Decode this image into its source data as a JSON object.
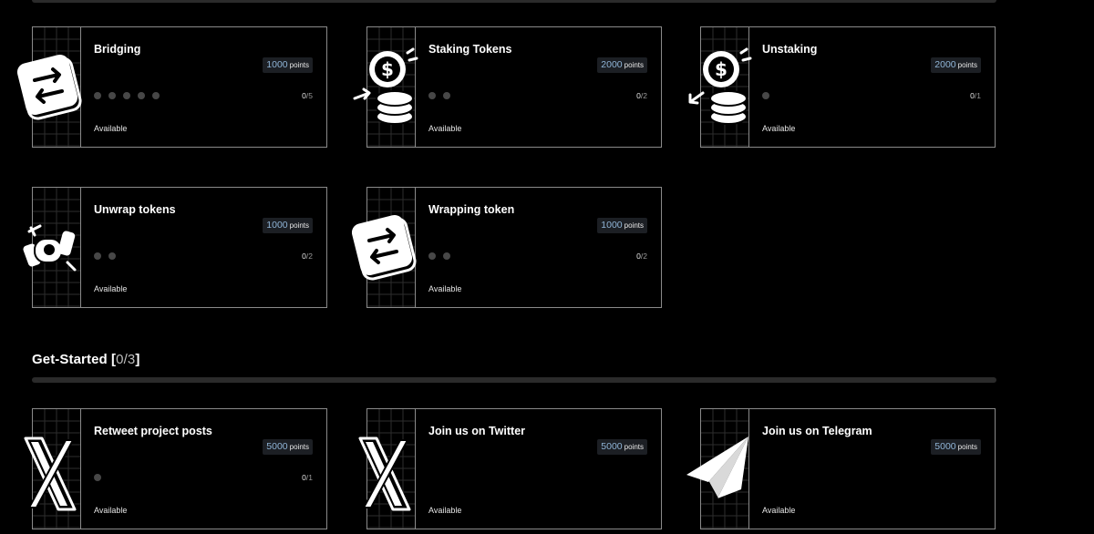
{
  "sections": {
    "get_started": {
      "title": "Get-Started",
      "done": "0",
      "total": "3"
    }
  },
  "cards": [
    {
      "title": "Bridging",
      "points": "1000",
      "points_unit": "points",
      "done": "0",
      "total": "5",
      "dots": 5,
      "status": "Available",
      "icon": "swap-arrows-icon"
    },
    {
      "title": "Staking Tokens",
      "points": "2000",
      "points_unit": "points",
      "done": "0",
      "total": "2",
      "dots": 2,
      "status": "Available",
      "icon": "dollar-coins-stake-icon"
    },
    {
      "title": "Unstaking",
      "points": "2000",
      "points_unit": "points",
      "done": "0",
      "total": "1",
      "dots": 1,
      "status": "Available",
      "icon": "dollar-coins-unstake-icon"
    },
    {
      "title": "Unwrap tokens",
      "points": "1000",
      "points_unit": "points",
      "done": "0",
      "total": "2",
      "dots": 2,
      "status": "Available",
      "icon": "candy-unwrap-icon"
    },
    {
      "title": "Wrapping token",
      "points": "1000",
      "points_unit": "points",
      "done": "0",
      "total": "2",
      "dots": 2,
      "status": "Available",
      "icon": "swap-arrows-icon"
    },
    {
      "title": "Retweet project posts",
      "points": "5000",
      "points_unit": "points",
      "done": "0",
      "total": "1",
      "dots": 1,
      "status": "Available",
      "icon": "x-logo-icon"
    },
    {
      "title": "Join us on Twitter",
      "points": "5000",
      "points_unit": "points",
      "done": "",
      "total": "",
      "dots": 0,
      "status": "Available",
      "icon": "x-logo-icon"
    },
    {
      "title": "Join us on Telegram",
      "points": "5000",
      "points_unit": "points",
      "done": "",
      "total": "",
      "dots": 0,
      "status": "Available",
      "icon": "paper-plane-icon"
    }
  ]
}
